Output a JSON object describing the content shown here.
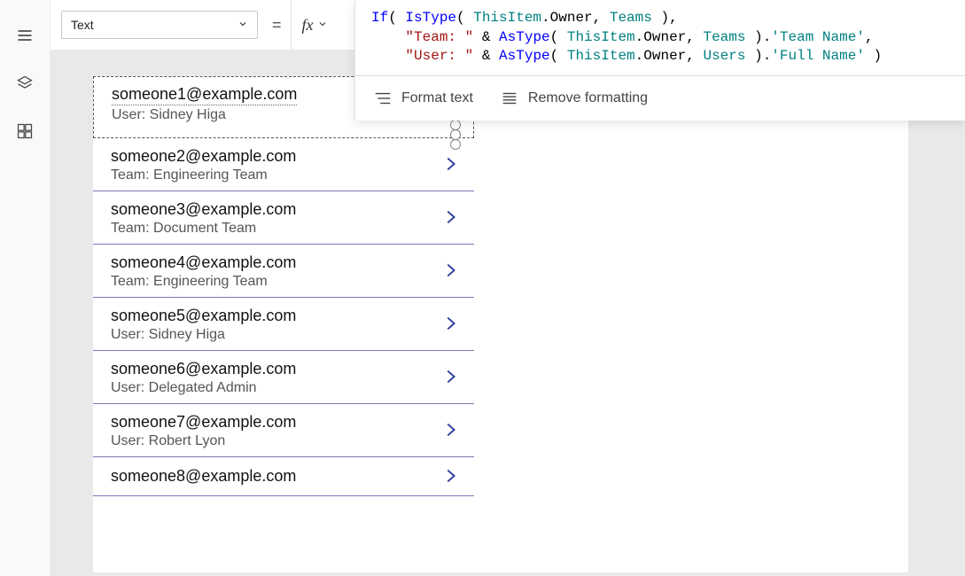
{
  "propertySelector": {
    "value": "Text"
  },
  "equals": "=",
  "fxLabel": "fx",
  "formulaTokens": [
    [
      {
        "t": "If",
        "c": "tk-blue"
      },
      {
        "t": "( ",
        "c": "tk-black"
      },
      {
        "t": "IsType",
        "c": "tk-blue"
      },
      {
        "t": "( ",
        "c": "tk-black"
      },
      {
        "t": "ThisItem",
        "c": "tk-teal"
      },
      {
        "t": ".Owner, ",
        "c": "tk-black"
      },
      {
        "t": "Teams",
        "c": "tk-teal"
      },
      {
        "t": " ),",
        "c": "tk-black"
      }
    ],
    [
      {
        "t": "    ",
        "c": "tk-black"
      },
      {
        "t": "\"Team: \"",
        "c": "tk-brown"
      },
      {
        "t": " & ",
        "c": "tk-black"
      },
      {
        "t": "AsType",
        "c": "tk-blue"
      },
      {
        "t": "( ",
        "c": "tk-black"
      },
      {
        "t": "ThisItem",
        "c": "tk-teal"
      },
      {
        "t": ".Owner, ",
        "c": "tk-black"
      },
      {
        "t": "Teams",
        "c": "tk-teal"
      },
      {
        "t": " ).",
        "c": "tk-black"
      },
      {
        "t": "'Team Name'",
        "c": "tk-teal"
      },
      {
        "t": ",",
        "c": "tk-black"
      }
    ],
    [
      {
        "t": "    ",
        "c": "tk-black"
      },
      {
        "t": "\"User: \"",
        "c": "tk-brown"
      },
      {
        "t": " & ",
        "c": "tk-black"
      },
      {
        "t": "AsType",
        "c": "tk-blue"
      },
      {
        "t": "( ",
        "c": "tk-black"
      },
      {
        "t": "ThisItem",
        "c": "tk-teal"
      },
      {
        "t": ".Owner, ",
        "c": "tk-black"
      },
      {
        "t": "Users",
        "c": "tk-teal"
      },
      {
        "t": " ).",
        "c": "tk-black"
      },
      {
        "t": "'Full Name'",
        "c": "tk-teal"
      },
      {
        "t": " )",
        "c": "tk-black"
      }
    ]
  ],
  "toolbar": {
    "format": "Format text",
    "remove": "Remove formatting"
  },
  "gallery": {
    "items": [
      {
        "title": "someone1@example.com",
        "sub": "User: Sidney Higa",
        "selected": true
      },
      {
        "title": "someone2@example.com",
        "sub": "Team: Engineering Team"
      },
      {
        "title": "someone3@example.com",
        "sub": "Team: Document Team"
      },
      {
        "title": "someone4@example.com",
        "sub": "Team: Engineering Team"
      },
      {
        "title": "someone5@example.com",
        "sub": "User: Sidney Higa"
      },
      {
        "title": "someone6@example.com",
        "sub": "User: Delegated Admin"
      },
      {
        "title": "someone7@example.com",
        "sub": "User: Robert Lyon"
      },
      {
        "title": "someone8@example.com",
        "sub": ""
      }
    ]
  }
}
